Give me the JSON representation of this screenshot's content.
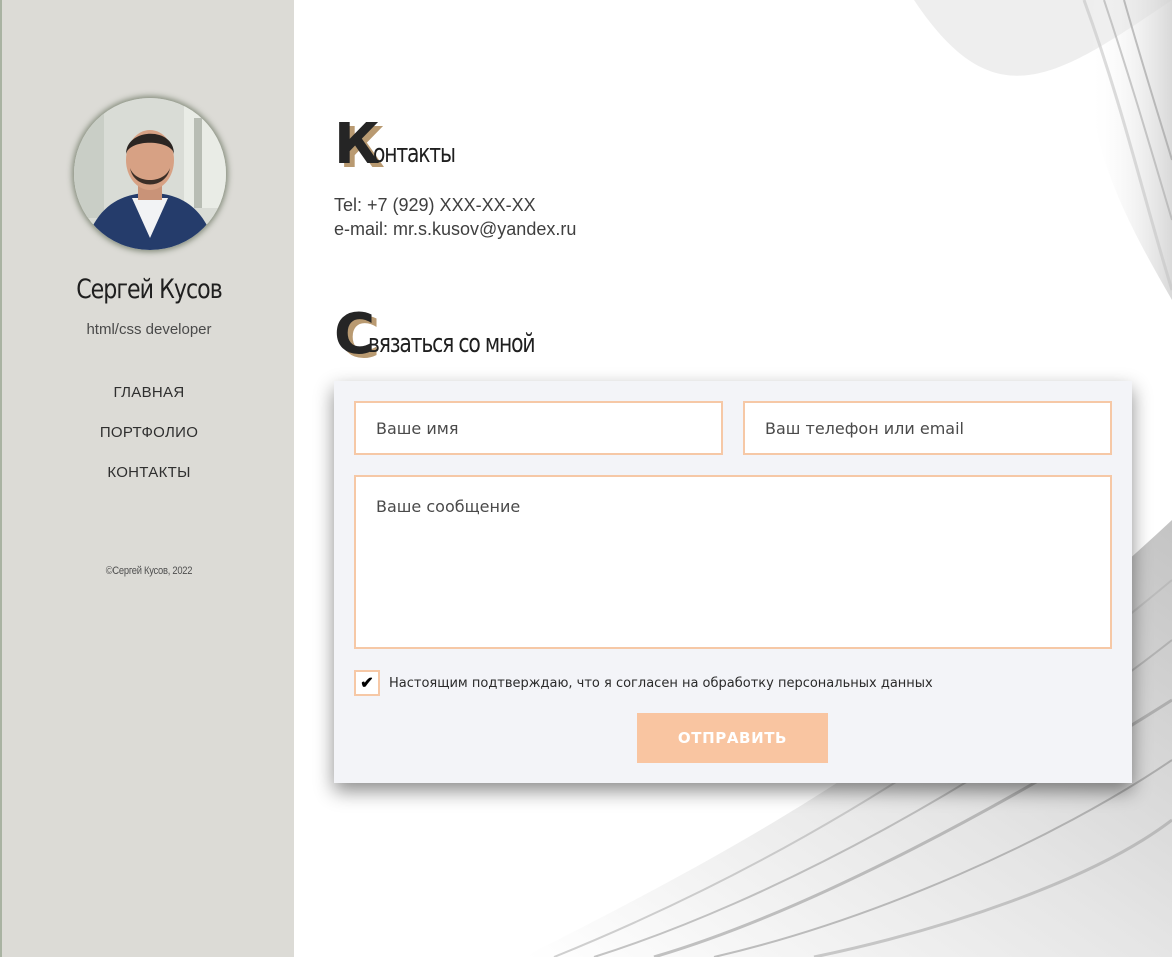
{
  "sidebar": {
    "name": "Сергей Кусов",
    "role": "html/css developer",
    "nav": [
      {
        "label": "ГЛАВНАЯ"
      },
      {
        "label": "ПОРТФОЛИО"
      },
      {
        "label": "КОНТАКТЫ"
      }
    ],
    "copyright": "©Сергей Кусов, 2022"
  },
  "contacts": {
    "heading_cap": "К",
    "heading_rest": "онтакты",
    "phone": "Tel: +7 (929) XXX-XX-XX",
    "email": "e-mail: mr.s.kusov@yandex.ru"
  },
  "connect": {
    "heading_cap": "С",
    "heading_rest": "вязаться со мной"
  },
  "form": {
    "name_placeholder": "Ваше имя",
    "contact_placeholder": "Ваш телефон или email",
    "message_placeholder": "Ваше сообщение",
    "consent_checked_mark": "✔",
    "consent_text": "Настоящим подтверждаю, что я согласен на обработку персональных данных",
    "submit_label": "ОТПРАВИТЬ"
  },
  "colors": {
    "sidebar_bg": "#dcdbd6",
    "accent_border": "#f6c8a6",
    "button_bg": "#f9c5a1",
    "heading_cap_shadow": "#b99a71",
    "form_bg": "#f3f4f8"
  }
}
